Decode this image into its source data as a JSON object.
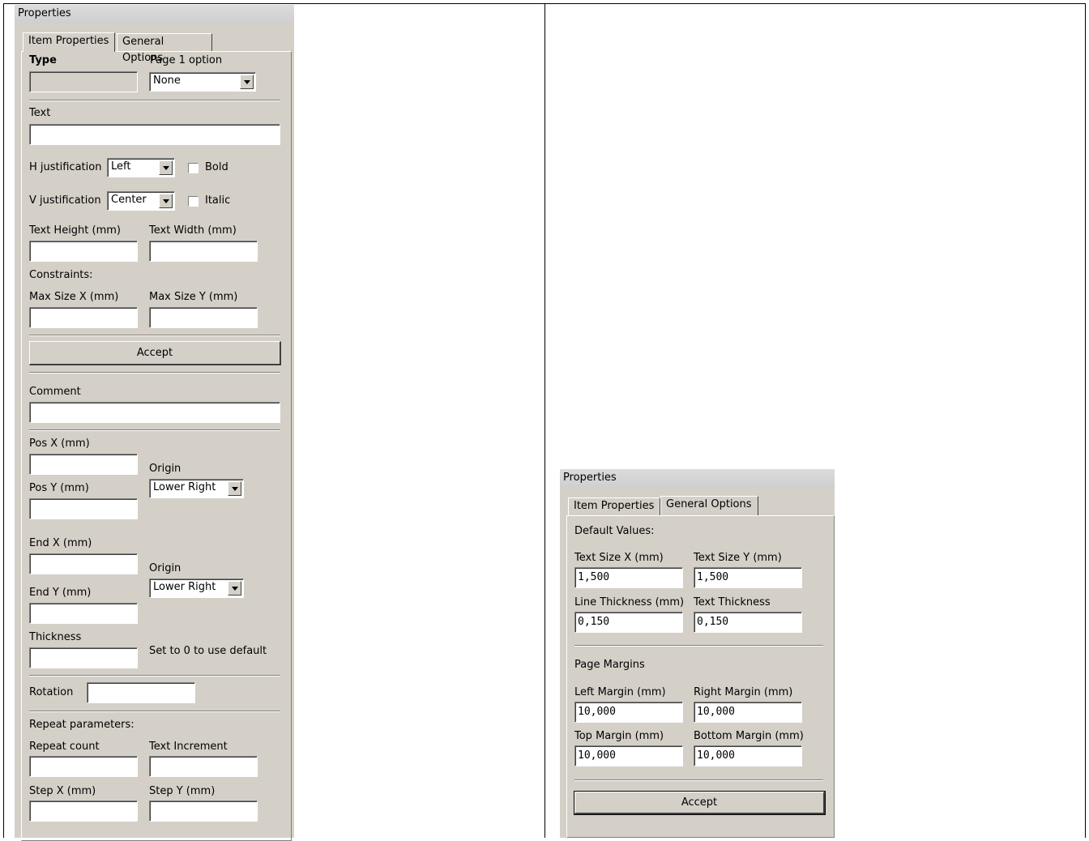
{
  "left_panel": {
    "title": "Properties",
    "tabs": [
      "Item Properties",
      "General Options"
    ],
    "type_label": "Type",
    "page1_option_label": "Page 1 option",
    "page1_option_value": "None",
    "text_label": "Text",
    "hjust_label": "H justification",
    "hjust_value": "Left",
    "bold_label": "Bold",
    "vjust_label": "V justification",
    "vjust_value": "Center",
    "italic_label": "Italic",
    "text_height_label": "Text Height (mm)",
    "text_width_label": "Text Width (mm)",
    "constraints_label": "Constraints:",
    "max_size_x_label": "Max Size X (mm)",
    "max_size_y_label": "Max Size Y (mm)",
    "accept_label": "Accept",
    "comment_label": "Comment",
    "pos_x_label": "Pos X (mm)",
    "pos_y_label": "Pos Y (mm)",
    "origin_label": "Origin",
    "origin_value": "Lower Right",
    "end_x_label": "End X (mm)",
    "end_y_label": "End Y (mm)",
    "origin2_label": "Origin",
    "origin2_value": "Lower Right",
    "thickness_label": "Thickness",
    "thickness_hint": "Set to 0 to use default",
    "rotation_label": "Rotation",
    "repeat_params_label": "Repeat parameters:",
    "repeat_count_label": "Repeat count",
    "text_increment_label": "Text Increment",
    "step_x_label": "Step X (mm)",
    "step_y_label": "Step Y (mm)"
  },
  "right_panel": {
    "title": "Properties",
    "tabs": [
      "Item Properties",
      "General Options"
    ],
    "default_values_label": "Default Values:",
    "text_size_x_label": "Text Size X (mm)",
    "text_size_x_value": "1,500",
    "text_size_y_label": "Text Size Y (mm)",
    "text_size_y_value": "1,500",
    "line_thickness_label": "Line Thickness (mm)",
    "line_thickness_value": "0,150",
    "text_thickness_label": "Text Thickness",
    "text_thickness_value": "0,150",
    "page_margins_label": "Page Margins",
    "left_margin_label": "Left Margin (mm)",
    "left_margin_value": "10,000",
    "right_margin_label": "Right Margin (mm)",
    "right_margin_value": "10,000",
    "top_margin_label": "Top Margin (mm)",
    "top_margin_value": "10,000",
    "bottom_margin_label": "Bottom Margin (mm)",
    "bottom_margin_value": "10,000",
    "accept_label": "Accept"
  }
}
